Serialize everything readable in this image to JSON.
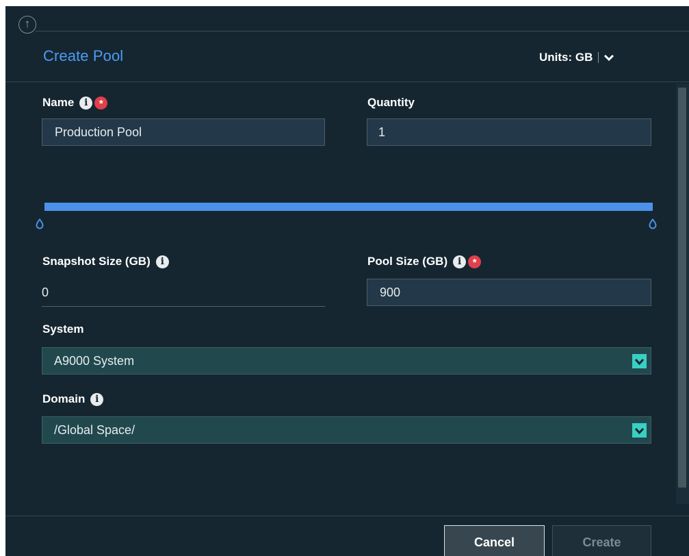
{
  "dialog": {
    "title": "Create Pool",
    "units_label": "Units: GB",
    "up_icon": "arrow-up-circle-icon"
  },
  "fields": {
    "name": {
      "label": "Name",
      "value": "Production Pool"
    },
    "quantity": {
      "label": "Quantity",
      "value": "1"
    },
    "snapshot_size": {
      "label": "Snapshot Size (GB)",
      "value": "0"
    },
    "pool_size": {
      "label": "Pool Size (GB)",
      "value": "900"
    },
    "system": {
      "label": "System",
      "value": "A9000 System"
    },
    "domain": {
      "label": "Domain",
      "value": "/Global Space/"
    }
  },
  "icons": {
    "info_glyph": "i",
    "required_glyph": "*"
  },
  "footer": {
    "cancel_label": "Cancel",
    "create_label": "Create"
  },
  "colors": {
    "background": "#152630",
    "accent": "#4b9cf5",
    "required": "#e0404a",
    "dropdown_arrow": "#39cfc2"
  }
}
